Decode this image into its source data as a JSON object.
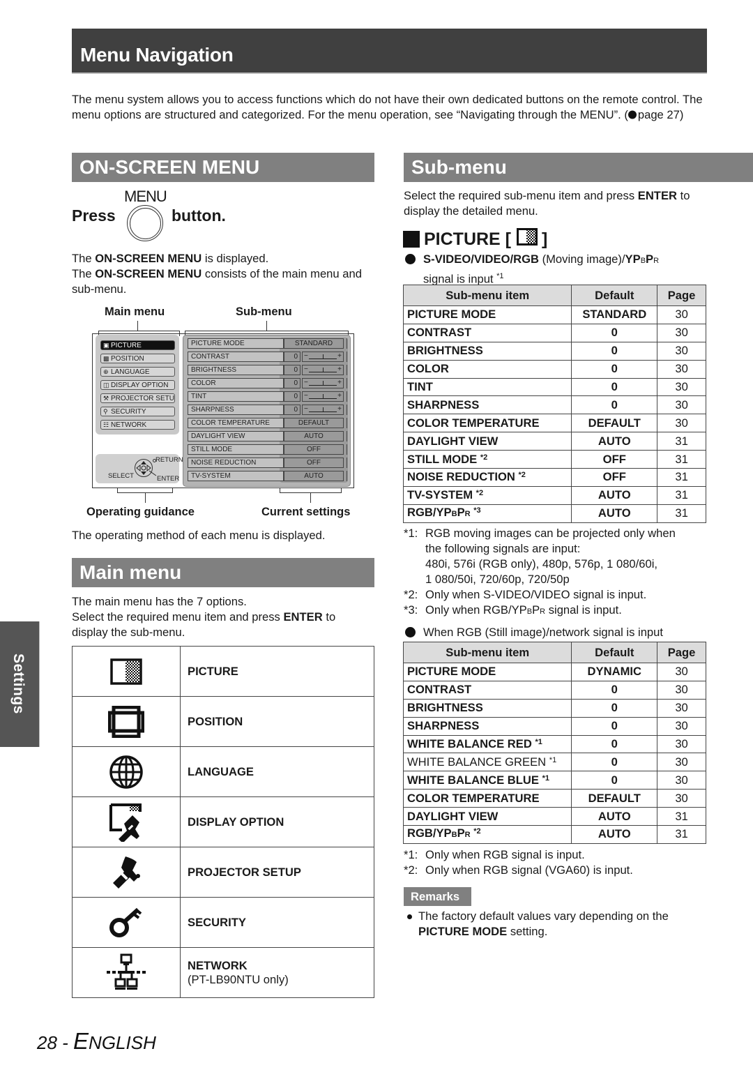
{
  "header": {
    "title": "Menu Navigation"
  },
  "intro": {
    "text_before_link": "The menu system allows you to access functions which do not have their own dedicated buttons on the remote control. The menu options are structured and categorized. For the menu operation, see “Navigating through the MENU”. (",
    "link_icon": "arrow-right-icon",
    "link_text": "page 27",
    "text_after_link": ")"
  },
  "onscreen": {
    "heading": "ON-SCREEN MENU",
    "press_word": "Press",
    "button_label": "MENU",
    "button_word": "button.",
    "line1_pre": "The ",
    "line1_bold": "ON-SCREEN MENU",
    "line1_post": " is displayed.",
    "line2_pre": "The ",
    "line2_bold": "ON-SCREEN MENU",
    "line2_post": " consists of the main menu and sub-menu.",
    "diagram": {
      "label_main": "Main menu",
      "label_sub": "Sub-menu",
      "label_guidance": "Operating guidance",
      "label_current": "Current settings",
      "main_items": [
        {
          "label": "PICTURE",
          "icon": "picture-icon",
          "selected": true
        },
        {
          "label": "POSITION",
          "icon": "position-icon"
        },
        {
          "label": "LANGUAGE",
          "icon": "globe-icon"
        },
        {
          "label": "DISPLAY OPTION",
          "icon": "display-option-icon"
        },
        {
          "label": "PROJECTOR SETUP",
          "icon": "wrench-icon"
        },
        {
          "label": "SECURITY",
          "icon": "key-icon"
        },
        {
          "label": "NETWORK",
          "icon": "network-icon"
        }
      ],
      "sub_items": [
        {
          "label": "PICTURE MODE",
          "value": "STANDARD"
        },
        {
          "label": "CONTRAST",
          "value": "0",
          "slider": true
        },
        {
          "label": "BRIGHTNESS",
          "value": "0",
          "slider": true
        },
        {
          "label": "COLOR",
          "value": "0",
          "slider": true
        },
        {
          "label": "TINT",
          "value": "0",
          "slider": true
        },
        {
          "label": "SHARPNESS",
          "value": "0",
          "slider": true
        },
        {
          "label": "COLOR TEMPERATURE",
          "value": "DEFAULT"
        },
        {
          "label": "DAYLIGHT VIEW",
          "value": "AUTO"
        },
        {
          "label": "STILL MODE",
          "value": "OFF"
        },
        {
          "label": "NOISE REDUCTION",
          "value": "OFF"
        },
        {
          "label": "TV-SYSTEM",
          "value": "AUTO"
        }
      ],
      "slider_minus": "−",
      "slider_plus": "+",
      "guide_select": "SELECT",
      "guide_return": "RETURN",
      "guide_enter": "ENTER"
    },
    "operating_note": "The operating method of each menu is displayed."
  },
  "main_menu": {
    "heading": "Main menu",
    "line1": "The main menu has the 7 options.",
    "line2_pre": "Select the required menu item and press ",
    "line2_bold": "ENTER",
    "line2_post": " to display the sub-menu.",
    "items": [
      {
        "label": "PICTURE",
        "icon": "picture-icon"
      },
      {
        "label": "POSITION",
        "icon": "position-icon"
      },
      {
        "label": "LANGUAGE",
        "icon": "globe-icon"
      },
      {
        "label": "DISPLAY OPTION",
        "icon": "display-option-icon"
      },
      {
        "label": "PROJECTOR SETUP",
        "icon": "wrench-icon"
      },
      {
        "label": "SECURITY",
        "icon": "key-icon"
      },
      {
        "label": "NETWORK",
        "note": "(PT-LB90NTU only)",
        "icon": "network-icon"
      }
    ]
  },
  "sub_menu": {
    "heading": "Sub-menu",
    "intro_pre": "Select the required sub-menu item and press ",
    "intro_bold": "ENTER",
    "intro_post": " to display the detailed menu.",
    "picture_heading": "PICTURE [",
    "picture_heading_end": "]",
    "case1": {
      "bold": "S-VIDEO/VIDEO/RGB",
      "text": " (Moving image)/",
      "ypbpr_y": "YP",
      "ypbpr_b": "B",
      "ypbpr_p": "P",
      "ypbpr_r": "R",
      "line2": "signal is input ",
      "line2_note": "*1"
    },
    "columns": [
      "Sub-menu item",
      "Default",
      "Page"
    ],
    "table1": [
      {
        "item": "PICTURE MODE",
        "default": "STANDARD",
        "page": "30"
      },
      {
        "item": "CONTRAST",
        "default": "0",
        "page": "30"
      },
      {
        "item": "BRIGHTNESS",
        "default": "0",
        "page": "30"
      },
      {
        "item": "COLOR",
        "default": "0",
        "page": "30"
      },
      {
        "item": "TINT",
        "default": "0",
        "page": "30"
      },
      {
        "item": "SHARPNESS",
        "default": "0",
        "page": "30"
      },
      {
        "item": "COLOR TEMPERATURE",
        "default": "DEFAULT",
        "page": "30"
      },
      {
        "item": "DAYLIGHT VIEW",
        "default": "AUTO",
        "page": "31"
      },
      {
        "item": "STILL MODE",
        "note": "*2",
        "default": "OFF",
        "page": "31"
      },
      {
        "item": "NOISE REDUCTION",
        "note": "*2",
        "default": "OFF",
        "page": "31"
      },
      {
        "item": "TV-SYSTEM",
        "note": "*2",
        "default": "AUTO",
        "page": "31"
      },
      {
        "item": "RGB/YP",
        "sub1": "B",
        "item2": "P",
        "sub2": "R",
        "note": "*3",
        "default": "AUTO",
        "page": "31"
      }
    ],
    "footnotes1": [
      {
        "tag": "*1:",
        "lines": [
          "RGB moving images can be projected only when",
          "the following signals are input:",
          "480i, 576i (RGB only), 480p, 576p, 1 080/60i,",
          "1 080/50i, 720/60p, 720/50p"
        ]
      },
      {
        "tag": "*2:",
        "lines": [
          "Only when S-VIDEO/VIDEO signal is input."
        ]
      },
      {
        "tag": "*3:",
        "pre": "Only when RGB/YP",
        "sub1": "B",
        "mid": "P",
        "sub2": "R",
        "post": " signal is input."
      }
    ],
    "case2": "When RGB (Still image)/network signal is input",
    "table2": [
      {
        "item": "PICTURE MODE",
        "default": "DYNAMIC",
        "page": "30"
      },
      {
        "item": "CONTRAST",
        "default": "0",
        "page": "30"
      },
      {
        "item": "BRIGHTNESS",
        "default": "0",
        "page": "30"
      },
      {
        "item": "SHARPNESS",
        "default": "0",
        "page": "30"
      },
      {
        "item": "WHITE BALANCE RED",
        "note": "*1",
        "default": "0",
        "page": "30"
      },
      {
        "item": "WHITE BALANCE GREEN",
        "note": "*1",
        "default": "0",
        "page": "30",
        "light": true
      },
      {
        "item": "WHITE BALANCE BLUE",
        "note": "*1",
        "default": "0",
        "page": "30"
      },
      {
        "item": "COLOR TEMPERATURE",
        "default": "DEFAULT",
        "page": "30"
      },
      {
        "item": "DAYLIGHT VIEW",
        "default": "AUTO",
        "page": "31"
      },
      {
        "item": "RGB/YP",
        "sub1": "B",
        "item2": "P",
        "sub2": "R",
        "note": "*2",
        "default": "AUTO",
        "page": "31"
      }
    ],
    "footnotes2": [
      {
        "tag": "*1:",
        "text": "Only when RGB signal is input."
      },
      {
        "tag": "*2:",
        "text": "Only when RGB signal (VGA60) is input."
      }
    ],
    "remarks_label": "Remarks",
    "remark_pre": "The factory default values vary depending on the ",
    "remark_bold": "PICTURE MODE",
    "remark_post": " setting."
  },
  "side_tab": {
    "label": "Settings"
  },
  "footer": {
    "page_number": "28",
    "separator": " - ",
    "lang_first": "E",
    "lang_rest": "NGLISH"
  }
}
